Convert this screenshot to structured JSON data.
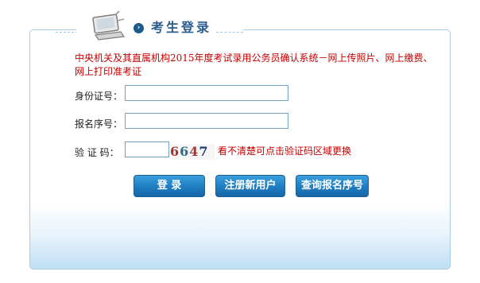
{
  "header": {
    "title": "考生登录"
  },
  "notice": "中央机关及其直属机构2015年度考试录用公务员确认系统－网上传照片、网上缴费、网上打印准考证",
  "form": {
    "id_label": "身份证号：",
    "id_value": "",
    "reg_label": "报名序号：",
    "reg_value": "",
    "captcha_label": "验 证 码：",
    "captcha_value": "",
    "captcha_digits": [
      "6",
      "6",
      "4",
      "7"
    ],
    "captcha_hint": "看不清楚可点击验证码区域更换"
  },
  "buttons": {
    "login": "登  录",
    "register": "注册新用户",
    "query": "查询报名序号"
  },
  "colors": {
    "accent": "#2a5c8f",
    "notice": "#c40000",
    "button": "#1f7cc0",
    "panel_border": "#a9cde6"
  }
}
